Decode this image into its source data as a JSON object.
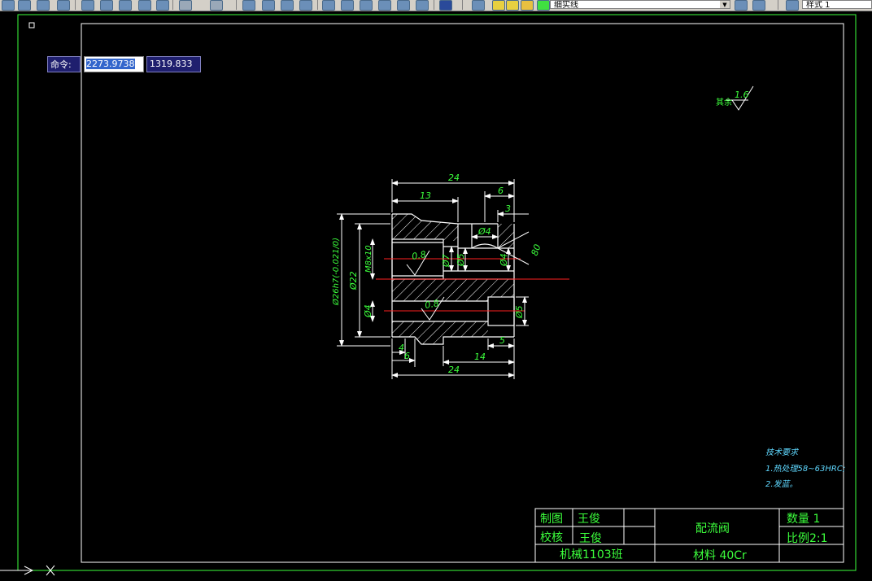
{
  "toolbar": {
    "layer_combo": "细实线",
    "style_combo": "样式 1"
  },
  "command": {
    "label": "命令:",
    "x_value": "2273.9738",
    "y_value": "1319.833"
  },
  "drawing": {
    "roughness_note_label": "其余",
    "roughness_note_value": "1.6",
    "dimensions": {
      "top_total": "24",
      "top_left": "13",
      "top_right": "6",
      "top_right_small": "3",
      "bottom_total": "24",
      "bottom_14": "14",
      "bottom_5": "5",
      "bottom_4": "4",
      "bottom_6": "6",
      "dia_outer": "Ø26h7(-0.021/0)",
      "dia_22": "Ø22",
      "thread": "M8x10",
      "dia_7": "Ø7",
      "dia_5_mid": "Ø5",
      "dia_4_top": "Ø4",
      "dia_4_right": "Ø4",
      "dia_4_left": "Ø4",
      "dia_5_right": "Ø5",
      "rough_08": "0.8",
      "rough_08b": "0.8",
      "angle": "80"
    },
    "tech_requirements": {
      "title": "技术要求",
      "line1": "1.热处理58~63HRC;",
      "line2": "2.发蓝。"
    }
  },
  "title_block": {
    "drawn_label": "制图",
    "drawn_name": "王俊",
    "checked_label": "校核",
    "checked_name": "王俊",
    "part_name": "配流阀",
    "quantity": "数量 1",
    "scale": "比例2:1",
    "class": "机械1103班",
    "material": "材料 40Cr"
  },
  "colors": {
    "background": "#000000",
    "frame": "#ffffff",
    "outer_frame": "#3cff3c",
    "part_outline": "#ffffff",
    "dimension": "#ffffff",
    "dimension_text": "#3cff3c",
    "center_line": "#ff2020",
    "tech_text": "#5fd8ff",
    "title_block_text": "#3cff3c"
  }
}
